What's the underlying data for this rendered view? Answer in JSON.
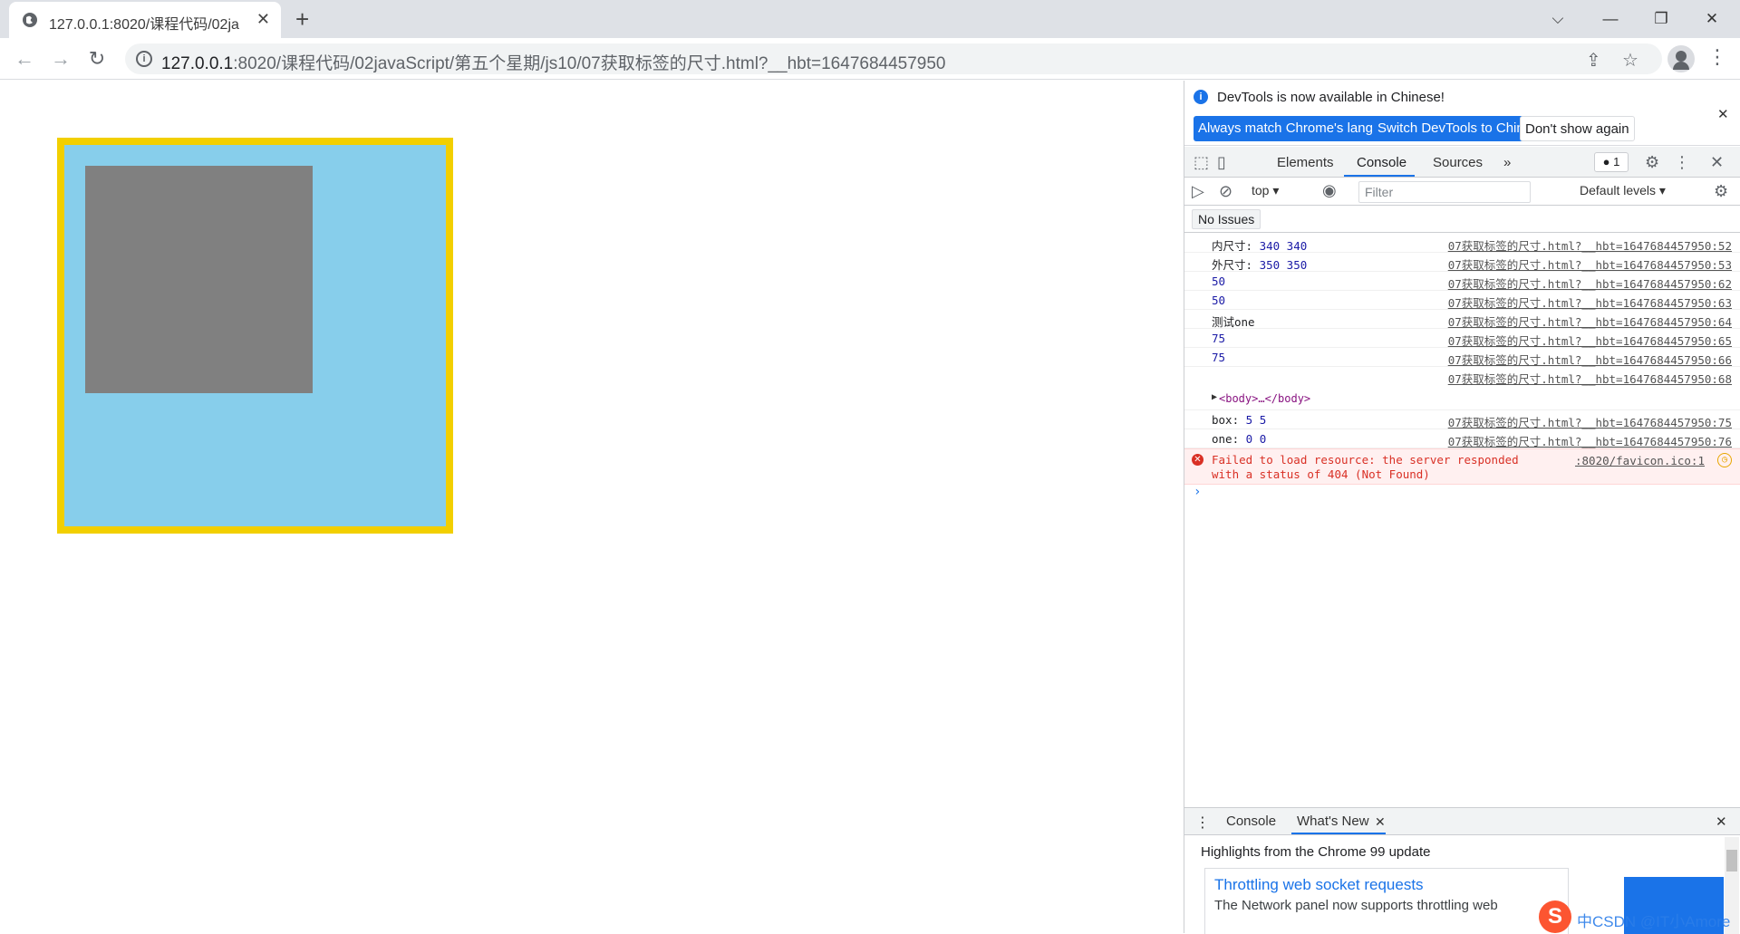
{
  "browser": {
    "tab_title": "127.0.0.1:8020/课程代码/02ja",
    "tab_close": "✕",
    "new_tab": "+",
    "url_host": "127.0.0.1",
    "url_rest": ":8020/课程代码/02javaScript/第五个星期/js10/07获取标签的尺寸.html?__hbt=1647684457950",
    "window_controls": {
      "dropdown": "⌵",
      "minimize": "—",
      "maximize": "❐",
      "close": "✕"
    }
  },
  "page": {
    "box_border_color": "#f2cf00",
    "box_bg_color": "#87ceeb",
    "inner_bg_color": "#808080"
  },
  "devtools": {
    "infobar": {
      "message": "DevTools is now available in Chinese!",
      "btn_match": "Always match Chrome's language",
      "btn_switch": "Switch DevTools to Chinese",
      "btn_dont_show": "Don't show again",
      "close": "✕"
    },
    "tabs": [
      "Elements",
      "Console",
      "Sources"
    ],
    "more_tabs": "»",
    "error_badge": "1",
    "console_context": "top ▾",
    "filter_placeholder": "Filter",
    "levels": "Default levels ▾",
    "issues": "No Issues",
    "messages": [
      {
        "label": "内尺寸: ",
        "value": "340 340",
        "source": "07获取标签的尺寸.html?__hbt=1647684457950:52"
      },
      {
        "label": "外尺寸: ",
        "value": "350 350",
        "source": "07获取标签的尺寸.html?__hbt=1647684457950:53"
      },
      {
        "label": "",
        "value": "50",
        "source": "07获取标签的尺寸.html?__hbt=1647684457950:62"
      },
      {
        "label": "",
        "value": "50",
        "source": "07获取标签的尺寸.html?__hbt=1647684457950:63"
      },
      {
        "label": "测试one",
        "value": "",
        "source": "07获取标签的尺寸.html?__hbt=1647684457950:64"
      },
      {
        "label": "",
        "value": "75",
        "source": "07获取标签的尺寸.html?__hbt=1647684457950:65"
      },
      {
        "label": "",
        "value": "75",
        "source": "07获取标签的尺寸.html?__hbt=1647684457950:66"
      },
      {
        "label": "",
        "value": "",
        "source": "07获取标签的尺寸.html?__hbt=1647684457950:68"
      }
    ],
    "body_node": "<body>…</body>",
    "messages_after": [
      {
        "label": "box: ",
        "value": "5 5",
        "source": "07获取标签的尺寸.html?__hbt=1647684457950:75"
      },
      {
        "label": "one: ",
        "value": "0 0",
        "source": "07获取标签的尺寸.html?__hbt=1647684457950:76"
      }
    ],
    "error_message": "Failed to load resource: the server responded with a status of 404 (Not Found)",
    "error_source": ":8020/favicon.ico:1",
    "prompt": "›",
    "drawer": {
      "tabs": [
        "Console",
        "What's New"
      ],
      "highlights": "Highlights from the Chrome 99 update",
      "news_title": "Throttling web socket requests",
      "news_desc": "The Network panel now supports throttling web"
    }
  },
  "watermark": {
    "logo": "S",
    "text": "中CSDN @IT小Amore"
  }
}
